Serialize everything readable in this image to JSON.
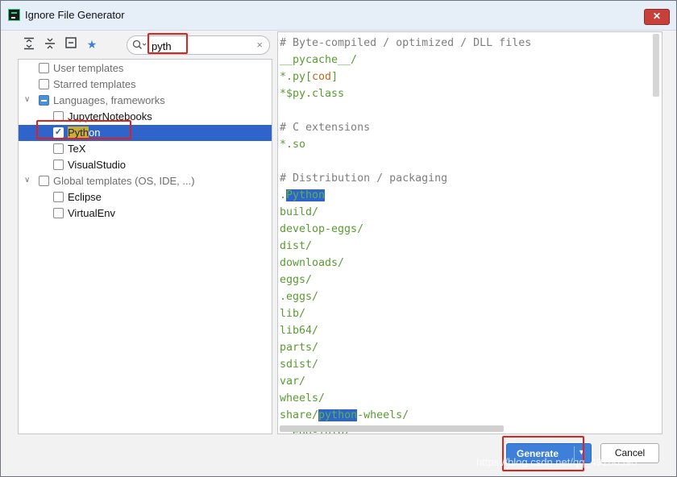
{
  "window": {
    "title": "Ignore File Generator",
    "close_label": "✕"
  },
  "toolbar": {
    "expand_all_icon": "expand-all-icon",
    "collapse_all_icon": "collapse-all-icon",
    "collapse_icon": "collapse-icon",
    "star_icon": "star-icon"
  },
  "search": {
    "value": "pyth",
    "clear_label": "×"
  },
  "tree": {
    "user_templates": "User templates",
    "starred_templates": "Starred templates",
    "languages": "Languages, frameworks",
    "jupyter": "JupyterNotebooks",
    "python_match": "Pyth",
    "python_rest": "on",
    "tex": "TeX",
    "visualstudio": "VisualStudio",
    "global": "Global templates (OS, IDE, ...)",
    "eclipse": "Eclipse",
    "virtualenv": "VirtualEnv"
  },
  "editor": {
    "l1": "# Byte-compiled / optimized / DLL files",
    "l2": "__pycache__/",
    "l3a": "*.py[",
    "l3b": "cod",
    "l3c": "]",
    "l4": "*$py.class",
    "l6": "# C extensions",
    "l7": "*.so",
    "l9": "# Distribution / packaging",
    "l10a": ".",
    "l10b": "Python",
    "l11": "build/",
    "l12": "develop-eggs/",
    "l13": "dist/",
    "l14": "downloads/",
    "l15": "eggs/",
    "l16": ".eggs/",
    "l17": "lib/",
    "l18": "lib64/",
    "l19": "parts/",
    "l20": "sdist/",
    "l21": "var/",
    "l22": "wheels/",
    "l23a": "share/",
    "l23b": "python",
    "l23c": "-wheels/",
    "l24": "*.egg-info/"
  },
  "buttons": {
    "generate": "Generate",
    "cancel": "Cancel"
  },
  "watermark": "https://blog.csdn.net/qq_49280390",
  "colors": {
    "accent": "#2f65ca",
    "highlight": "#c9ad3a",
    "annotation": "#e0211e",
    "code_green": "#5a9a33"
  }
}
